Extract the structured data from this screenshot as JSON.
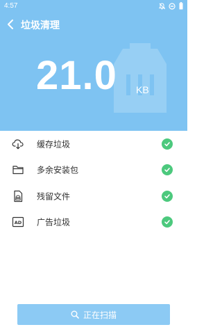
{
  "status_bar": {
    "time": "4:57",
    "icons": [
      "notifications-off-icon",
      "do-not-disturb-icon",
      "battery-icon"
    ]
  },
  "header": {
    "back_icon": "back-arrow-icon",
    "title": "垃圾清理"
  },
  "summary": {
    "size_value": "21.0",
    "size_unit": "KB"
  },
  "items": [
    {
      "label": "缓存垃圾",
      "icon": "cloud-download-icon",
      "checked": true
    },
    {
      "label": "多余安装包",
      "icon": "folder-icon",
      "checked": true
    },
    {
      "label": "残留文件",
      "icon": "apk-file-icon",
      "checked": true
    },
    {
      "label": "广告垃圾",
      "icon": "ad-icon",
      "checked": true
    }
  ],
  "scan_button": {
    "label": "正在扫描",
    "icon": "search-icon"
  },
  "colors": {
    "hero_bg": "#7ec3f2",
    "check_green": "#4cc97d",
    "button_bg": "#8ccaf4"
  }
}
